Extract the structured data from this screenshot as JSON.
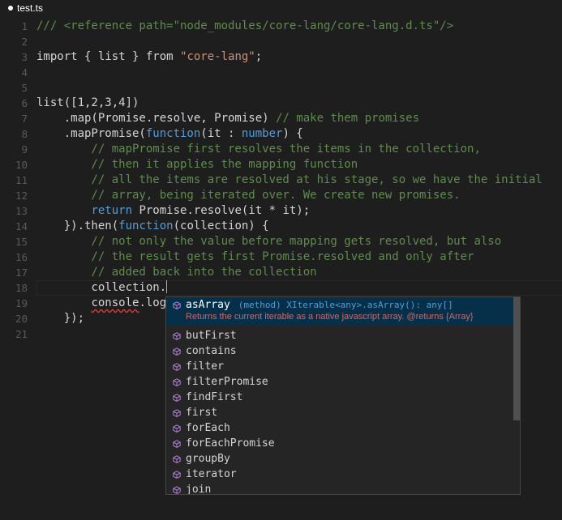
{
  "tab": {
    "title": "test.ts",
    "dirty": true
  },
  "lines": [
    {
      "n": "1",
      "segs": [
        [
          "c",
          "/// <reference path=\"node_modules/core-lang/core-lang.d.ts\"/>"
        ]
      ]
    },
    {
      "n": "2",
      "segs": []
    },
    {
      "n": "3",
      "segs": [
        [
          "p",
          "import { list } from "
        ],
        [
          "s",
          "\"core-lang\""
        ],
        [
          "p",
          ";"
        ]
      ]
    },
    {
      "n": "4",
      "segs": []
    },
    {
      "n": "5",
      "segs": []
    },
    {
      "n": "6",
      "segs": [
        [
          "p",
          "list([1,2,3,4])"
        ]
      ]
    },
    {
      "n": "7",
      "segs": [
        [
          "p",
          "    .map(Promise.resolve, Promise) "
        ],
        [
          "c",
          "// make them promises"
        ]
      ]
    },
    {
      "n": "8",
      "segs": [
        [
          "p",
          "    .mapPromise("
        ],
        [
          "k",
          "function"
        ],
        [
          "p",
          "(it : "
        ],
        [
          "k",
          "number"
        ],
        [
          "p",
          ") {"
        ]
      ]
    },
    {
      "n": "9",
      "segs": [
        [
          "c",
          "        // mapPromise first resolves the items in the collection,"
        ]
      ]
    },
    {
      "n": "10",
      "segs": [
        [
          "c",
          "        // then it applies the mapping function"
        ]
      ]
    },
    {
      "n": "11",
      "segs": [
        [
          "c",
          "        // all the items are resolved at his stage, so we have the initial"
        ]
      ]
    },
    {
      "n": "12",
      "segs": [
        [
          "c",
          "        // array, being iterated over. We create new promises."
        ]
      ]
    },
    {
      "n": "13",
      "segs": [
        [
          "p",
          "        "
        ],
        [
          "k",
          "return"
        ],
        [
          "p",
          " Promise.resolve(it * it);"
        ]
      ]
    },
    {
      "n": "14",
      "segs": [
        [
          "p",
          "    }).then("
        ],
        [
          "k",
          "function"
        ],
        [
          "p",
          "(collection) {"
        ]
      ]
    },
    {
      "n": "15",
      "segs": [
        [
          "c",
          "        // not only the value before mapping gets resolved, but also"
        ]
      ]
    },
    {
      "n": "16",
      "segs": [
        [
          "c",
          "        // the result gets first Promise.resolved and only after"
        ]
      ]
    },
    {
      "n": "17",
      "segs": [
        [
          "c",
          "        // added back into the collection"
        ]
      ]
    },
    {
      "n": "18",
      "segs": [
        [
          "p",
          "        collection."
        ]
      ],
      "current": true
    },
    {
      "n": "19",
      "segs": [
        [
          "p",
          "        "
        ],
        [
          "q",
          "console"
        ],
        [
          "p",
          ".log"
        ]
      ]
    },
    {
      "n": "20",
      "segs": [
        [
          "p",
          "    });"
        ]
      ]
    },
    {
      "n": "21",
      "segs": []
    }
  ],
  "suggest": {
    "selected": {
      "label": "asArray",
      "detail": "(method) XIterable<any>.asArray(): any[]",
      "doc": "Returns the current iterable as a native javascript array. @returns {Array}"
    },
    "items": [
      "butFirst",
      "contains",
      "filter",
      "filterPromise",
      "findFirst",
      "first",
      "forEach",
      "forEachPromise",
      "groupBy",
      "iterator",
      "join"
    ],
    "icon": "method-cube-icon",
    "icon_color": "#b180d7"
  },
  "colors": {
    "comment": "#608b4e",
    "string": "#ce9178",
    "keyword": "#569cd6",
    "text": "#d4d4d4",
    "selection": "#062f4a"
  }
}
